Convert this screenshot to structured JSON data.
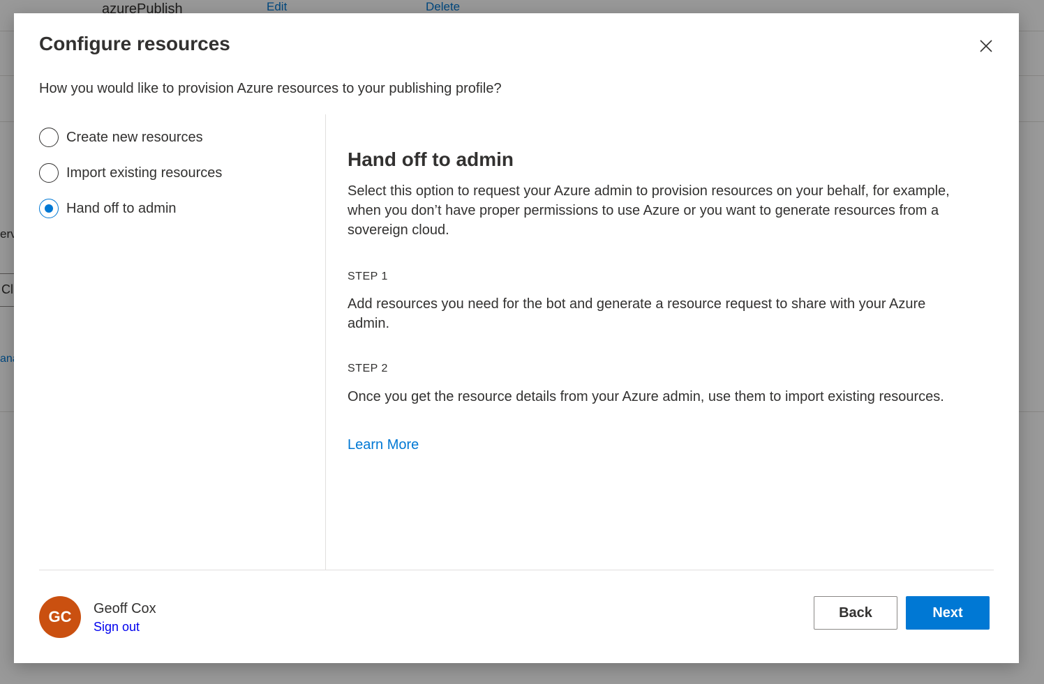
{
  "background": {
    "row_name": "azurePublish",
    "edit_link": "Edit",
    "delete_link": "Delete",
    "fragment_serv": "erv",
    "fragment_input": "Cl",
    "fragment_link": "ana"
  },
  "dialog": {
    "title": "Configure resources",
    "subtitle": "How you would like to provision Azure resources to your publishing profile?",
    "close_icon": "close-icon",
    "options": [
      {
        "label": "Create new resources",
        "selected": false
      },
      {
        "label": "Import existing resources",
        "selected": false
      },
      {
        "label": "Hand off to admin",
        "selected": true
      }
    ],
    "detail": {
      "title": "Hand off to admin",
      "description": "Select this option to request your Azure admin to provision resources on your behalf, for example, when you don’t have proper permissions to use Azure or you want to generate resources from a sovereign cloud.",
      "step1_label": "STEP 1",
      "step1_text": "Add resources you need for the bot and generate a resource request to share with your Azure admin.",
      "step2_label": "STEP 2",
      "step2_text": "Once you get the resource details from your Azure admin, use them to import existing resources.",
      "learn_more": "Learn More"
    },
    "footer": {
      "avatar_initials": "GC",
      "user_name": "Geoff Cox",
      "sign_out": "Sign out",
      "back_label": "Back",
      "next_label": "Next"
    }
  },
  "colors": {
    "accent": "#0078d4",
    "avatar_bg": "#ca5010",
    "overlay": "rgba(0,0,0,0.40)"
  }
}
